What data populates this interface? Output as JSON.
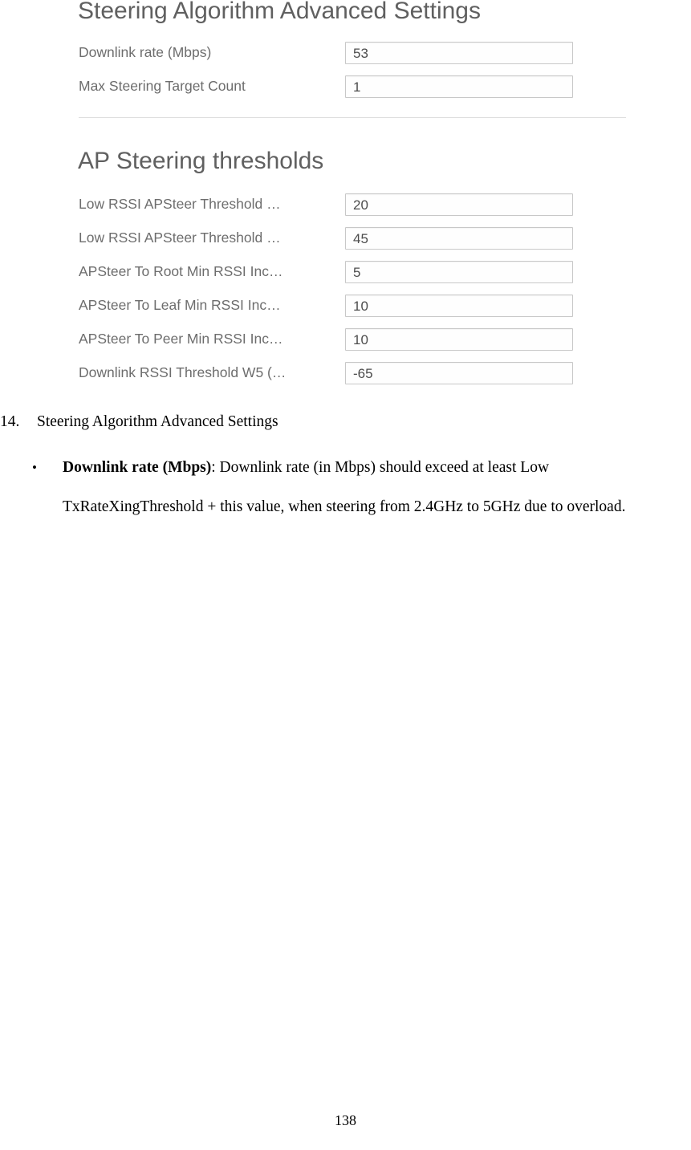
{
  "screenshot": {
    "title_main": "Steering Algorithm Advanced Settings",
    "title_second": "AP Steering thresholds",
    "rows_top": [
      {
        "label": "Downlink rate (Mbps)",
        "value": "53"
      },
      {
        "label": "Max Steering Target Count",
        "value": "1"
      }
    ],
    "rows_thresholds": [
      {
        "label": "Low RSSI APSteer Threshold …",
        "value": "20"
      },
      {
        "label": "Low RSSI APSteer Threshold …",
        "value": "45"
      },
      {
        "label": "APSteer To Root Min RSSI Inc…",
        "value": "5"
      },
      {
        "label": "APSteer To Leaf Min RSSI Inc…",
        "value": "10"
      },
      {
        "label": "APSteer To Peer Min RSSI Inc…",
        "value": "10"
      },
      {
        "label": "Downlink RSSI Threshold W5 (…",
        "value": "-65"
      }
    ]
  },
  "document": {
    "numbered_item": {
      "marker": "14.",
      "text": "Steering Algorithm Advanced Settings"
    },
    "bullet": {
      "marker": "•",
      "term": "Downlink rate (Mbps)",
      "body": ": Downlink rate (in Mbps) should exceed at least Low TxRateXingThreshold + this value, when steering from 2.4GHz to 5GHz due to overload."
    },
    "page_number": "138"
  }
}
